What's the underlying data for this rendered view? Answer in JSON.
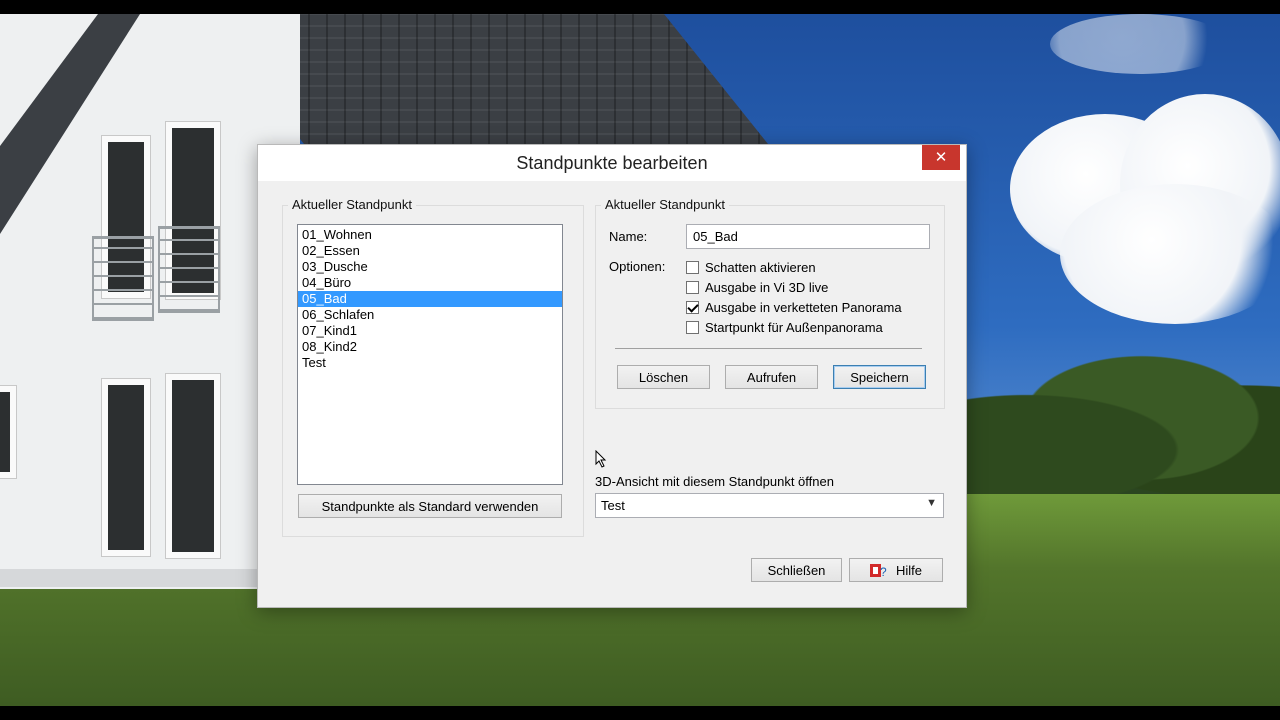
{
  "dialog": {
    "title": "Standpunkte bearbeiten",
    "close_glyph": "✕",
    "list_group_label": "Aktueller Standpunkt",
    "details_group_label": "Aktueller Standpunkt",
    "list_items": [
      "01_Wohnen",
      "02_Essen",
      "03_Dusche",
      "04_Büro",
      "05_Bad",
      "06_Schlafen",
      "07_Kind1",
      "08_Kind2",
      "Test"
    ],
    "selected_item": "05_Bad",
    "use_standard_button": "Standpunkte als Standard verwenden",
    "name_label": "Name:",
    "name_value": "05_Bad",
    "options_label": "Optionen:",
    "options": [
      {
        "label": "Schatten aktivieren",
        "checked": false
      },
      {
        "label": "Ausgabe in Vi 3D live",
        "checked": false
      },
      {
        "label": "Ausgabe in verketteten Panorama",
        "checked": true
      },
      {
        "label": "Startpunkt für Außenpanorama",
        "checked": false
      }
    ],
    "delete_button": "Löschen",
    "call_button": "Aufrufen",
    "save_button": "Speichern",
    "open_3d_label": "3D-Ansicht mit diesem Standpunkt öffnen",
    "open_3d_value": "Test",
    "close_button": "Schließen",
    "help_button": "Hilfe"
  },
  "colors": {
    "close_bg": "#c8362d",
    "selection": "#3399ff",
    "dialog_bg": "#f0f0f0"
  },
  "icons": {
    "close": "close-icon",
    "help": "help-icon",
    "dropdown": "chevron-down-icon",
    "cursor": "mouse-cursor-icon"
  }
}
